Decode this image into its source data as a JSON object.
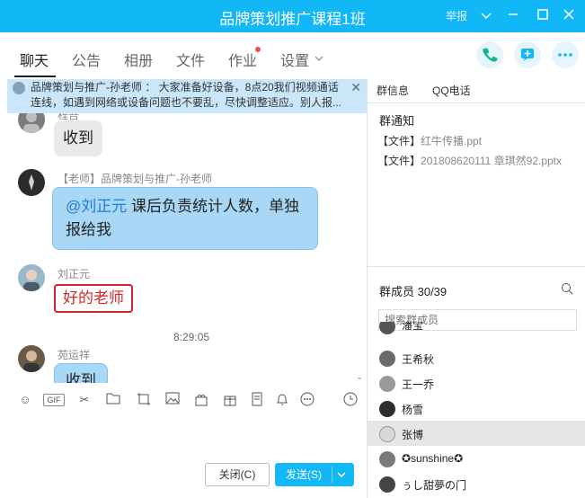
{
  "window": {
    "title": "品牌策划推广课程1班",
    "report_label": "举报",
    "accent": "#12b7f5"
  },
  "tabs": [
    {
      "label": "聊天",
      "active": true
    },
    {
      "label": "公告"
    },
    {
      "label": "相册"
    },
    {
      "label": "文件"
    },
    {
      "label": "作业",
      "badge": true
    },
    {
      "label": "设置"
    }
  ],
  "notice": {
    "text": "品牌策划与推广-孙老师 ： 大家准备好设备，8点20我们视频通话连线，如遇到网络或设备问题也不要乱，尽快调整适应。别人报..."
  },
  "messages": [
    {
      "sender": "程吾",
      "text": "收到"
    },
    {
      "sender": "【老师】品牌策划与推广-孙老师",
      "mention": "@刘正元",
      "text": "课后负责统计人数，单独报给我"
    },
    {
      "sender": "刘正元",
      "text": "好的老师"
    },
    {
      "sender": "苑运祥",
      "text": "收到"
    }
  ],
  "time_separator": "8:29:05",
  "toolbar_icons": [
    "emoji-icon",
    "gif-icon",
    "scissors-icon",
    "folder-icon",
    "screenshot-icon",
    "image-icon",
    "gift-box-icon",
    "present-icon",
    "voice-icon",
    "bell-icon",
    "more-icon",
    "history-icon"
  ],
  "buttons": {
    "close": "关闭(C)",
    "send": "发送(S)"
  },
  "right_panel": {
    "tabs": [
      "群信息",
      "QQ电话"
    ],
    "notice_title": "群通知",
    "files": [
      {
        "prefix": "【文件】",
        "name": "红牛传播.ppt"
      },
      {
        "prefix": "【文件】",
        "name": "201808620111 章琪然92.pptx"
      }
    ],
    "members_title": "群成员 30/39",
    "search_placeholder": "搜索群成员",
    "members": [
      {
        "name": "潘宝"
      },
      {
        "name": "王希秋"
      },
      {
        "name": "王一乔"
      },
      {
        "name": "杨雪"
      },
      {
        "name": "张博",
        "selected": true
      },
      {
        "name": "✪sunshine✪"
      },
      {
        "name": "ぅし甜夢の门"
      }
    ]
  }
}
